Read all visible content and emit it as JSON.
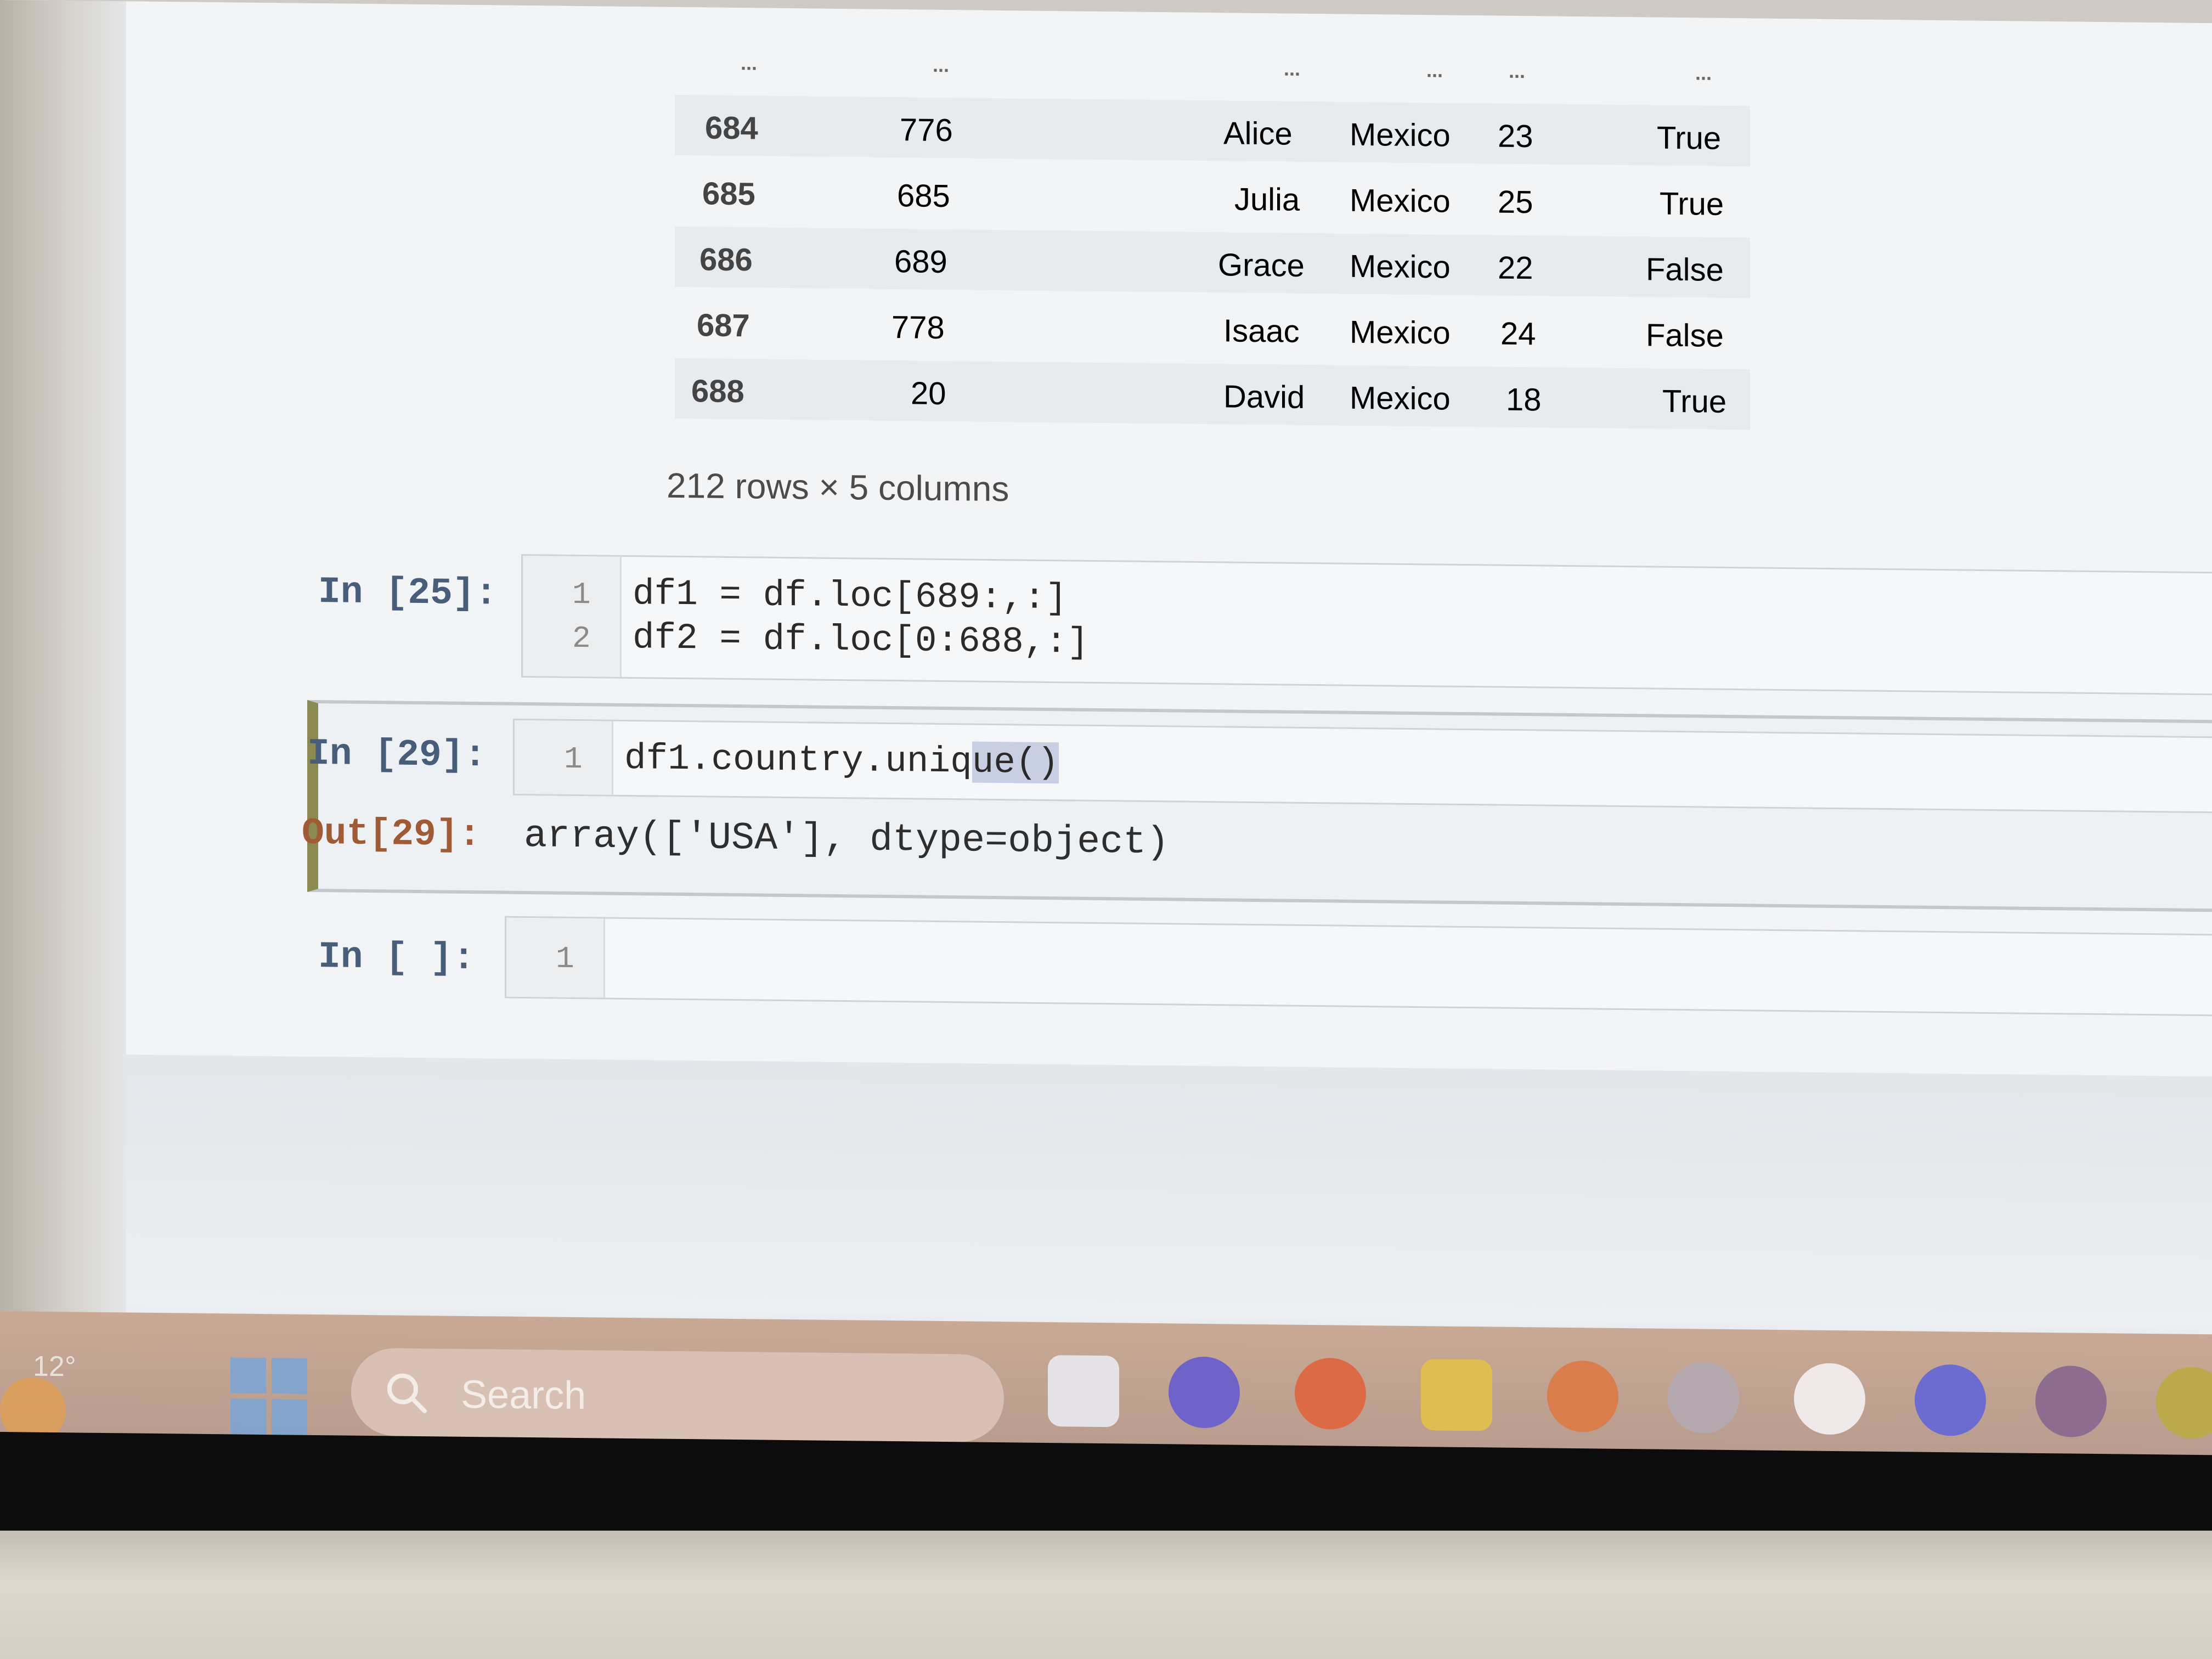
{
  "dataframe": {
    "ellipsis": "...",
    "rows": [
      {
        "index": "684",
        "col1": "776",
        "name": "Alice",
        "country": "Mexico",
        "age": "23",
        "flag": "True"
      },
      {
        "index": "685",
        "col1": "685",
        "name": "Julia",
        "country": "Mexico",
        "age": "25",
        "flag": "True"
      },
      {
        "index": "686",
        "col1": "689",
        "name": "Grace",
        "country": "Mexico",
        "age": "22",
        "flag": "False"
      },
      {
        "index": "687",
        "col1": "778",
        "name": "Isaac",
        "country": "Mexico",
        "age": "24",
        "flag": "False"
      },
      {
        "index": "688",
        "col1": "20",
        "name": "David",
        "country": "Mexico",
        "age": "18",
        "flag": "True"
      }
    ],
    "summary": "212 rows × 5 columns"
  },
  "cells": {
    "c25": {
      "prompt": "In [25]:",
      "lines": [
        {
          "no": "1",
          "code": "df1 = df.loc[689:,:]"
        },
        {
          "no": "2",
          "code": "df2 = df.loc[0:688,:]"
        }
      ]
    },
    "c29": {
      "prompt": "In [29]:",
      "lines": [
        {
          "no": "1",
          "code_pre": "df1.country.uniq",
          "code_sel": "ue()"
        }
      ],
      "out_prompt": "Out[29]:",
      "output": "array(['USA'], dtype=object)"
    },
    "cempty": {
      "prompt": "In [ ]:",
      "lines": [
        {
          "no": "1"
        }
      ]
    }
  },
  "taskbar": {
    "weather_temp": "12°",
    "search_label": "Search",
    "icons": [
      "task-view-icon",
      "meet-icon",
      "opera-icon",
      "file-explorer-icon",
      "firefox-icon",
      "steam-icon",
      "slack-icon",
      "discord-icon",
      "github-icon",
      "app-icon"
    ]
  }
}
